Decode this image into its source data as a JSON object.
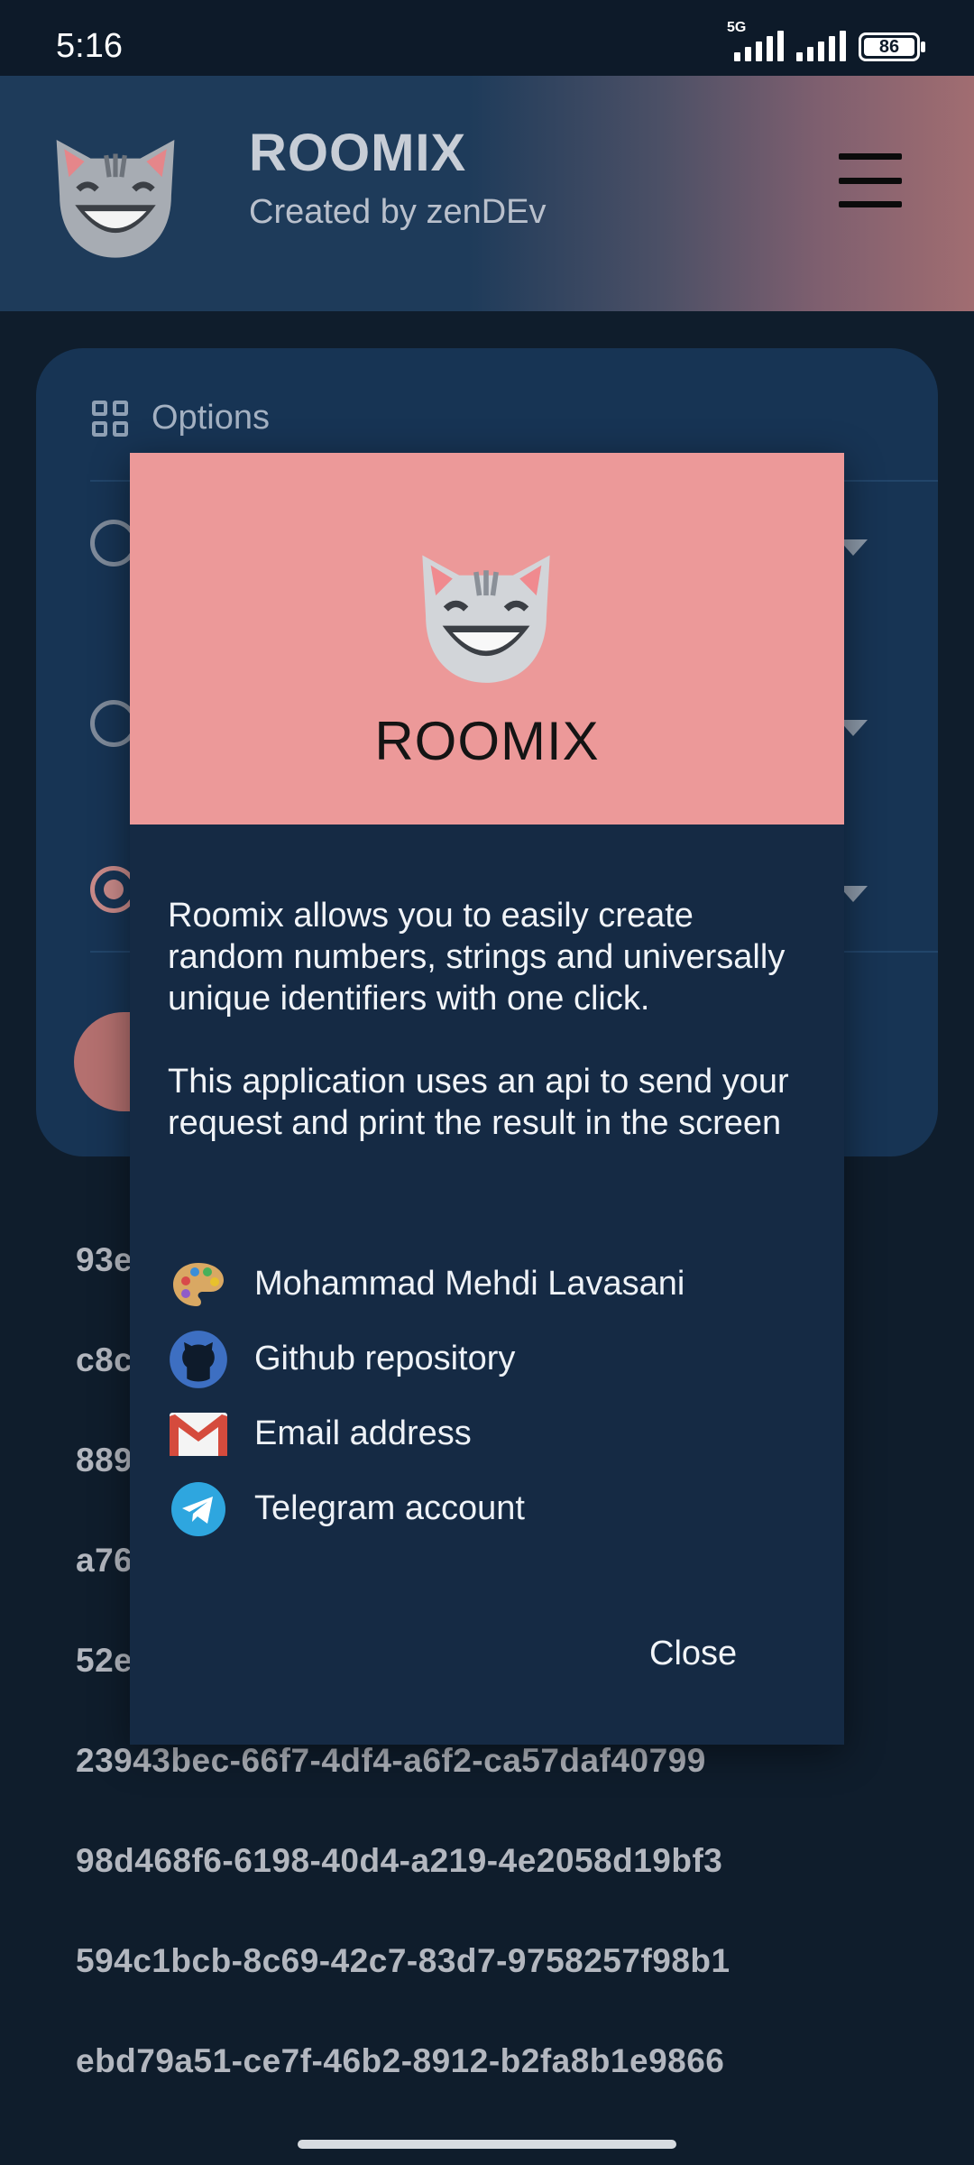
{
  "status_bar": {
    "time": "5:16",
    "network": "5G",
    "battery": "86"
  },
  "app_bar": {
    "title": "ROOMIX",
    "subtitle": "Created by zenDEv",
    "menu_icon": "hamburger-menu-icon"
  },
  "options_card": {
    "header_label": "Options",
    "header_icon": "grid-icon",
    "selected_option_index": 2
  },
  "results": [
    "93e",
    "c8c",
    "889",
    "a76",
    "52e",
    "23943bec-66f7-4df4-a6f2-ca57daf40799",
    "98d468f6-6198-40d4-a219-4e2058d19bf3",
    "594c1bcb-8c69-42c7-83d7-9758257f98b1",
    "ebd79a51-ce7f-46b2-8912-b2fa8b1e9866"
  ],
  "dialog": {
    "title": "ROOMIX",
    "paragraphs": [
      "Roomix allows you to easily create random numbers, strings and universally unique identifiers with one click.",
      "This application uses an api to send your request and print the result in the screen"
    ],
    "links": [
      {
        "icon": "palette-icon",
        "label": "Mohammad Mehdi Lavasani"
      },
      {
        "icon": "github-icon",
        "label": "Github repository"
      },
      {
        "icon": "gmail-icon",
        "label": "Email address"
      },
      {
        "icon": "telegram-icon",
        "label": "Telegram account"
      }
    ],
    "close_label": "Close"
  },
  "colors": {
    "background": "#0f1d2c",
    "card": "#173454",
    "dialog": "#152a44",
    "dialog_header": "#ec9999",
    "accent": "#c98a89"
  }
}
